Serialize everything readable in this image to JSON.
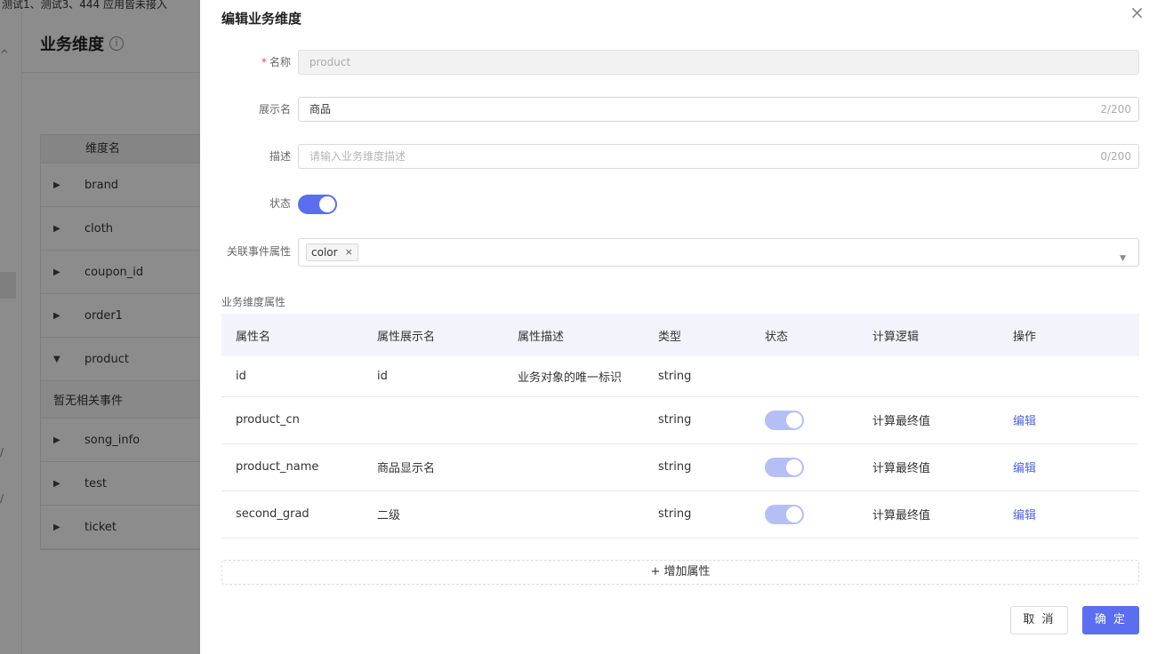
{
  "background": {
    "banner": "测试1、测试3、444 应用皆未接入",
    "page_title": "业务维度",
    "table_header": "维度名",
    "rows": [
      {
        "label": "brand",
        "expanded": false
      },
      {
        "label": "cloth",
        "expanded": false
      },
      {
        "label": "coupon_id",
        "expanded": false
      },
      {
        "label": "order1",
        "expanded": false
      },
      {
        "label": "product",
        "expanded": true
      },
      {
        "label": "song_info",
        "expanded": false
      },
      {
        "label": "test",
        "expanded": false
      },
      {
        "label": "ticket",
        "expanded": false
      }
    ],
    "empty_events": "暂无相关事件"
  },
  "drawer": {
    "title": "编辑业务维度",
    "close_icon": "close-icon",
    "form": {
      "name_label": "名称",
      "name_required_mark": "*",
      "name_value": "product",
      "display_label": "展示名",
      "display_value": "商品",
      "display_count": "2/200",
      "desc_label": "描述",
      "desc_placeholder": "请输入业务维度描述",
      "desc_count": "0/200",
      "status_label": "状态",
      "status_on": true,
      "event_attr_label": "关联事件属性",
      "event_attr_tags": [
        "color"
      ],
      "tag_remove": "×",
      "select_arrow": "▼"
    },
    "attributes_section_title": "业务维度属性",
    "attributes_table": {
      "columns": [
        "属性名",
        "属性展示名",
        "属性描述",
        "类型",
        "状态",
        "计算逻辑",
        "操作"
      ],
      "rows": [
        {
          "name": "id",
          "display": "id",
          "desc": "业务对象的唯一标识",
          "type": "string",
          "status": null,
          "logic": "",
          "action": ""
        },
        {
          "name": "product_cn",
          "display": "",
          "desc": "",
          "type": "string",
          "status": true,
          "logic": "计算最终值",
          "action": "编辑"
        },
        {
          "name": "product_name",
          "display": "商品显示名",
          "desc": "",
          "type": "string",
          "status": true,
          "logic": "计算最终值",
          "action": "编辑"
        },
        {
          "name": "second_grad",
          "display": "二级",
          "desc": "",
          "type": "string",
          "status": true,
          "logic": "计算最终值",
          "action": "编辑"
        }
      ]
    },
    "add_attribute": "+ 增加属性",
    "cancel": "取 消",
    "confirm": "确 定"
  },
  "colors": {
    "primary": "#5b6ef0",
    "link": "#4f63e8",
    "required": "#e5484d",
    "table_header_bg": "#f3f4fb"
  }
}
